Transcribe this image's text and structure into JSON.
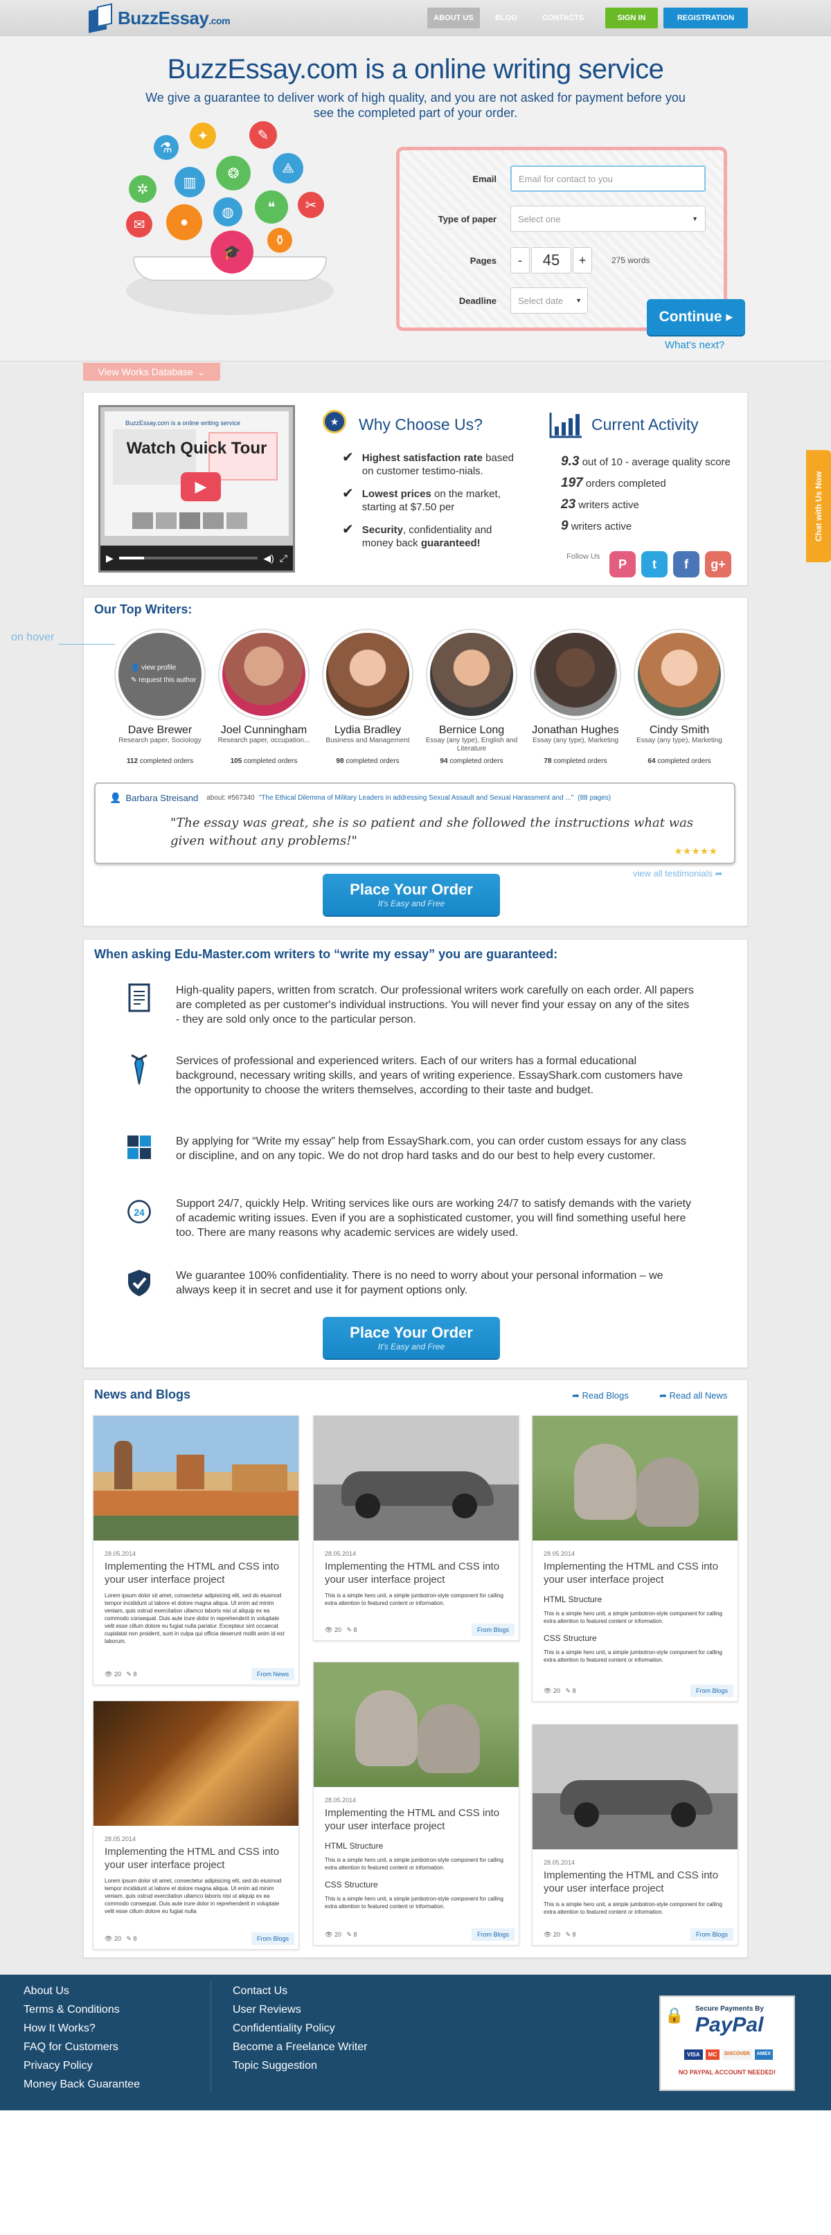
{
  "header": {
    "logo": "BuzzEssay",
    "logo_suffix": ".com",
    "nav": [
      "ABOUT US",
      "BLOG",
      "CONTACTS"
    ],
    "sign_in": "SIGN IN",
    "registration": "REGISTRATION"
  },
  "hero": {
    "title": "BuzzEssay.com is a online writing service",
    "subtitle": "We give a guarantee to deliver work of high quality, and you are not asked for payment before you see the completed part of your order."
  },
  "form": {
    "email_label": "Email",
    "email_placeholder": "Email for contact to you",
    "type_label": "Type of paper",
    "type_value": "Select one",
    "pages_label": "Pages",
    "pages_minus": "-",
    "pages_value": "45",
    "pages_plus": "+",
    "words": "275 words",
    "deadline_label": "Deadline",
    "deadline_value": "Select date",
    "continue": "Continue",
    "whats_next": "What's next?"
  },
  "works_db": "View Works Database",
  "video": {
    "overlay": "Watch Quick Tour",
    "mini_title": "BuzzEssay.com is a online writing service"
  },
  "why": {
    "title": "Why Choose Us?",
    "items": [
      {
        "b": "Highest satisfaction rate",
        "t": " based on   customer testimo-nials."
      },
      {
        "b": "Lowest prices",
        "t": " on the market, starting at $7.50 per"
      },
      {
        "b": "Security",
        "t": ", confidentiality and money back ",
        "b2": "guaranteed!"
      }
    ]
  },
  "activity": {
    "title": "Current Activity",
    "rows": [
      {
        "v": "9.3",
        "t": " out of 10 - average quality score"
      },
      {
        "v": "197",
        "t": " orders completed"
      },
      {
        "v": "23",
        "t": " writers active"
      },
      {
        "v": "9",
        "t": " writers active"
      }
    ],
    "follow": "Follow Us"
  },
  "chat": "Chat with Us Now",
  "writers": {
    "title": "Our Top Writers:",
    "hover": "on hover",
    "hover_view": "view profile",
    "hover_request": "request this author",
    "list": [
      {
        "name": "Dave Brewer",
        "role": "Research paper, Sociology",
        "count": "112",
        "color": "#7a6a5a"
      },
      {
        "name": "Joel Cunningham",
        "role": "Research paper, occupation...",
        "count": "105",
        "color": "#a55d4f"
      },
      {
        "name": "Lydia Bradley",
        "role": "Business and Management",
        "count": "98",
        "color": "#8c5a3f"
      },
      {
        "name": "Bernice Long",
        "role": "Essay (any type), English and Literature",
        "count": "94",
        "color": "#6b5448"
      },
      {
        "name": "Jonathan Hughes",
        "role": "Essay (any type), Marketing",
        "count": "78",
        "color": "#4a3a34"
      },
      {
        "name": "Cindy Smith",
        "role": "Essay (any type), Marketing",
        "count": "64",
        "color": "#b9784c"
      }
    ],
    "completed": "completed orders"
  },
  "testimonial": {
    "author": "Barbara Streisand",
    "about": "about: #567340",
    "topic": "\"The Ethical Dilemma of Military Leaders in addressing Sexual Assault and Sexual Harassment and ...\"",
    "pages": "(88 pages)",
    "quote": "\"The essay was great, she is so patient and she followed the instructions what was given without any problems!\"",
    "stars": "★★★★★",
    "view_all": "view all testimonials"
  },
  "order": {
    "label": "Place Your Order",
    "sub": "It's Easy and Free"
  },
  "guarantee": {
    "title": "When asking Edu-Master.com writers to “write my essay” you are guaranteed:",
    "items": [
      "High-quality papers, written from scratch. Our professional writers work carefully on each order. All papers are completed as per customer's individual instructions. You will never find your essay on any of the sites - they are sold only once to the particular person.",
      "Services of professional and experienced writers. Each of our writers has a formal educational background, necessary writing skills, and years of writing experience. EssayShark.com customers have the opportunity to choose the writers themselves, according to their taste and budget.",
      "By applying for “Write my essay” help from EssayShark.com, you can order custom essays for any class or discipline, and on any topic. We do not drop hard tasks and do our best to help every customer.",
      "Support 24/7, quickly Help. Writing services like ours are working 24/7 to satisfy demands with the variety of academic writing issues. Even if you are a sophisticated customer, you will find something useful here too. There are many reasons why academic services are widely used.",
      "We guarantee 100% confidentiality. There is no need to worry about your personal information – we always keep it in secret and use it for payment options only."
    ],
    "icon24": "24"
  },
  "news": {
    "title": "News and Blogs",
    "read_blogs": "Read Blogs",
    "read_news": "Read all News",
    "date": "28.05.2014",
    "card_title": "Implementing the HTML and CSS into your user interface project",
    "lorem": "Lorem ipsum dolor sit amet, consectetur adipisicing elit, sed do eiusmod tempor incididunt ut labore et dolore magna aliqua. Ut enim ad minim veniam, quis ostrud exercitation ullamco laboris nisi ut aliquip ex ea commodo consequat. Duis aute irure dolor in reprehenderit in voluptate velit esse cillum dolore eu fugiat nulla pariatur. Excepteur sint occaecat cupidatat non proident, sunt in culpa qui officia deserunt mollit anim id est laborum.",
    "lorem_short": "Lorem ipsum dolor sit amet, consectetur adipisicing elit, sed do eiusmod tempor incididunt ut labore et dolore magna aliqua. Ut enim ad minim veniam, quis ostrud exercitation ullamco laboris nisi ut aliquip ex ea commodo consequat. Duis aute irure dolor in reprehenderit in voluptate velit esse cillum dolore eu fugiat nulla",
    "hero_unit": "This is a simple hero unit, a simple jumbotron-style component for calling extra attention to featured content or information.",
    "html_structure": "HTML Structure",
    "css_structure": "CSS Structure",
    "views": "20",
    "comments": "8",
    "from_news": "From News",
    "from_blogs": "From Blogs"
  },
  "footer": {
    "col1": [
      "About Us",
      "Terms & Conditions",
      "How It Works?",
      "FAQ for Customers",
      "Privacy Policy",
      "Money Back Guarantee"
    ],
    "col2": [
      "Contact Us",
      "User Reviews",
      "Confidentiality Policy",
      "Become a Freelance Writer",
      "Topic Suggestion"
    ],
    "paypal_top": "Secure Payments By",
    "paypal": "PayPal",
    "paypal_note": "NO PAYPAL ACCOUNT NEEDED!",
    "cards": [
      "VISA",
      "MC",
      "DISCOVER",
      "AMEX"
    ]
  },
  "colors": {
    "brand": "#1a4e87",
    "accent": "#1a8ed0",
    "green": "#6aba28",
    "footer": "#1d4b6e",
    "orange": "#f5a623"
  }
}
